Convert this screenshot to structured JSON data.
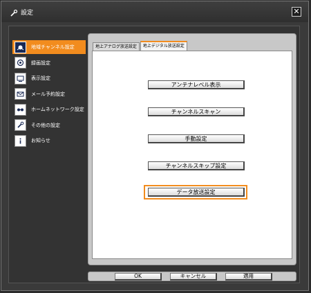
{
  "window": {
    "title": "設定"
  },
  "sidebar": {
    "items": [
      {
        "label": "地域チャンネル設定",
        "icon": "broadcast-icon",
        "active": true
      },
      {
        "label": "録画設定",
        "icon": "record-icon",
        "active": false
      },
      {
        "label": "表示設定",
        "icon": "display-icon",
        "active": false
      },
      {
        "label": "メール予約設定",
        "icon": "mail-icon",
        "active": false
      },
      {
        "label": "ホームネットワーク設定",
        "icon": "network-icon",
        "active": false
      },
      {
        "label": "その他の設定",
        "icon": "tools-icon",
        "active": false
      },
      {
        "label": "お知らせ",
        "icon": "info-icon",
        "active": false
      }
    ]
  },
  "tabs": [
    {
      "label": "地上アナログ放送設定",
      "active": false
    },
    {
      "label": "地上デジタル放送設定",
      "active": true
    }
  ],
  "buttons": [
    "アンテナレベル表示",
    "チャンネルスキャン",
    "手動設定",
    "チャンネルスキップ設定",
    "データ放送設定"
  ],
  "footer": {
    "ok": "OK",
    "cancel": "キャンセル",
    "apply": "適用"
  },
  "colors": {
    "accent": "#f28c1e",
    "window_bg": "#3a3a3a",
    "panel_bg": "#c8c8c8"
  }
}
